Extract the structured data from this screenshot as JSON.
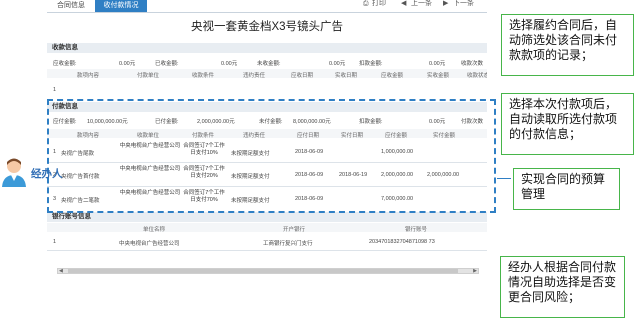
{
  "tabs": [
    "合同信息",
    "收付款情况"
  ],
  "toolbar": {
    "print": "打印",
    "prev": "上一条",
    "next": "下一条"
  },
  "title": "央视一套黄金档X3号镜头广告",
  "receipt": {
    "section": "收款信息",
    "summary": [
      "应收金额:",
      "0.00元",
      "已收金额:",
      "0.00元",
      "未收金额:",
      "0.00元",
      "扣款金额:",
      "0.00元",
      "收款次数"
    ],
    "headers": [
      "款项内容",
      "付款单位",
      "收款条件",
      "违约责任",
      "应收日期",
      "实收日期",
      "应收金额",
      "实收金额",
      "收款状态"
    ],
    "first_row_no": "1"
  },
  "payment": {
    "section": "付款信息",
    "summary": [
      "应付金额:",
      "10,000,000.00元",
      "已付金额:",
      "2,000,000.00元",
      "未付金额:",
      "8,000,000.00元",
      "扣款金额:",
      "0.00元",
      "付款次数"
    ],
    "headers": [
      "款项内容",
      "收款单位",
      "付款条件",
      "违约责任",
      "应付日期",
      "实付日期",
      "应付金额",
      "实付金额"
    ],
    "rows": [
      {
        "no": "1",
        "item": "央视广告尾款",
        "unit": "中央电视台广告经营公司",
        "cond": "合同签订7个工作日支付10%",
        "duty": "未按期足额支付",
        "due": "2018-06-09",
        "paid_date": "",
        "due_amt": "1,000,000.00",
        "paid_amt": ""
      },
      {
        "no": "2",
        "item": "央视广告首付款",
        "unit": "中央电视台广告经营公司",
        "cond": "合同签订7个工作日支付20%",
        "duty": "未按期足额支付",
        "due": "2018-06-09",
        "paid_date": "2018-06-19",
        "due_amt": "2,000,000.00",
        "paid_amt": "2,000,000.00"
      },
      {
        "no": "3",
        "item": "央视广告二笔款",
        "unit": "中央电视台广告经营公司",
        "cond": "合同签订7个工作日支付70%",
        "duty": "未按期足额支付",
        "due": "2018-06-09",
        "paid_date": "",
        "due_amt": "7,000,000.00",
        "paid_amt": ""
      }
    ]
  },
  "bank": {
    "section": "银行账号信息",
    "headers": [
      "单位名称",
      "开户银行",
      "银行账号"
    ],
    "row": {
      "no": "1",
      "name": "中央电视台广告经营公司",
      "bank": "工商银行复兴门支行",
      "account": "2034701832704871098 73"
    }
  },
  "callouts": [
    "选择履约合同后，自动筛选处该合同未付款款项的记录；",
    "选择本次付款项后，自动读取所选付款项的付款信息；",
    "实现合同的预算管理",
    "经办人根据合同付款情况自助选择是否变更合同风险；"
  ],
  "role": "经办人",
  "colors": {
    "accent": "#2f7fc4",
    "callout_border": "#47b54a",
    "role_text": "#2f6db5"
  }
}
